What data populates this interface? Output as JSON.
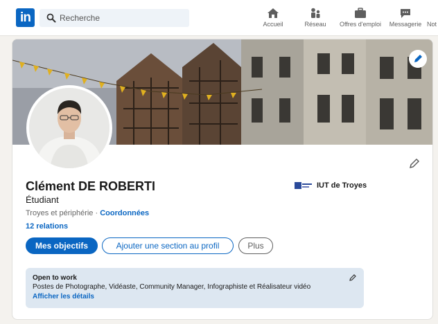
{
  "nav": {
    "logo_text": "in",
    "search_placeholder": "Recherche",
    "items": [
      {
        "label": "Accueil",
        "icon": "home-icon"
      },
      {
        "label": "Réseau",
        "icon": "network-icon"
      },
      {
        "label": "Offres d'emploi",
        "icon": "briefcase-icon"
      },
      {
        "label": "Messagerie",
        "icon": "messaging-icon"
      },
      {
        "label": "Not",
        "icon": "bell-icon"
      }
    ]
  },
  "profile": {
    "name": "Clément DE ROBERTI",
    "headline": "Étudiant",
    "location": "Troyes et périphérie",
    "separator": "·",
    "contact_link": "Coordonnées",
    "relations": "12 relations",
    "school": "IUT de Troyes"
  },
  "actions": {
    "primary": "Mes objectifs",
    "secondary": "Ajouter une section au profil",
    "more": "Plus"
  },
  "open_to_work": {
    "title": "Open to work",
    "description": "Postes de Photographe, Vidéaste, Community Manager, Infographiste et Réalisateur vidéo",
    "link": "Afficher les détails"
  },
  "colors": {
    "brand": "#0a66c2",
    "otw_background": "#dde7f1"
  }
}
